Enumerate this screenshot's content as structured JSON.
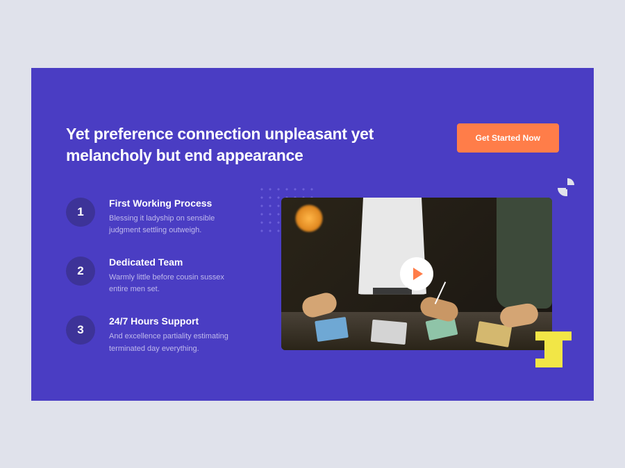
{
  "hero": {
    "title": "Yet preference connection unpleasant yet melancholy but end appearance",
    "cta": "Get Started Now"
  },
  "steps": [
    {
      "num": "1",
      "title": "First Working Process",
      "desc": "Blessing it ladyship on sensible judgment settling outweigh."
    },
    {
      "num": "2",
      "title": "Dedicated Team",
      "desc": "Warmly little before cousin sussex entire men set."
    },
    {
      "num": "3",
      "title": "24/7 Hours Support",
      "desc": "And excellence partiality estimating terminated day everything."
    }
  ]
}
